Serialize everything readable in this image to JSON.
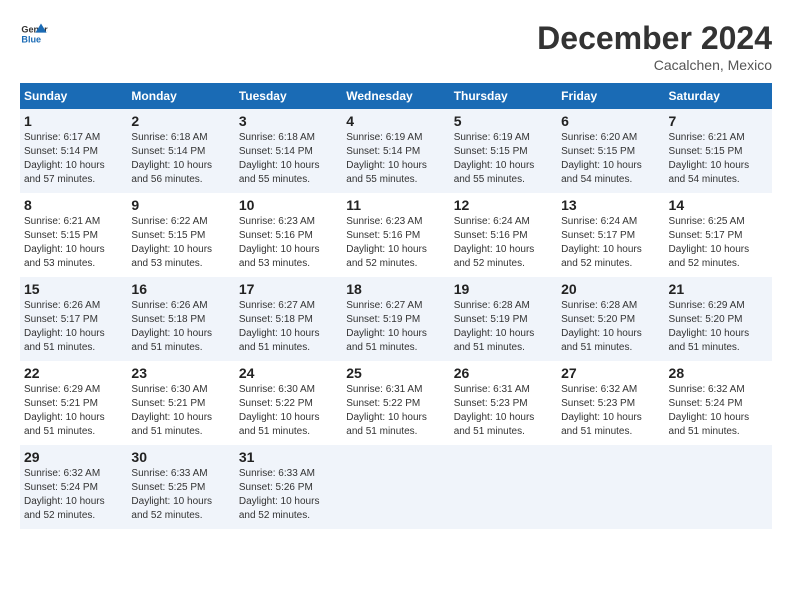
{
  "logo": {
    "line1": "General",
    "line2": "Blue"
  },
  "title": "December 2024",
  "location": "Cacalchen, Mexico",
  "weekdays": [
    "Sunday",
    "Monday",
    "Tuesday",
    "Wednesday",
    "Thursday",
    "Friday",
    "Saturday"
  ],
  "weeks": [
    [
      {
        "day": "1",
        "sunrise": "6:17 AM",
        "sunset": "5:14 PM",
        "daylight": "10 hours and 57 minutes."
      },
      {
        "day": "2",
        "sunrise": "6:18 AM",
        "sunset": "5:14 PM",
        "daylight": "10 hours and 56 minutes."
      },
      {
        "day": "3",
        "sunrise": "6:18 AM",
        "sunset": "5:14 PM",
        "daylight": "10 hours and 55 minutes."
      },
      {
        "day": "4",
        "sunrise": "6:19 AM",
        "sunset": "5:14 PM",
        "daylight": "10 hours and 55 minutes."
      },
      {
        "day": "5",
        "sunrise": "6:19 AM",
        "sunset": "5:15 PM",
        "daylight": "10 hours and 55 minutes."
      },
      {
        "day": "6",
        "sunrise": "6:20 AM",
        "sunset": "5:15 PM",
        "daylight": "10 hours and 54 minutes."
      },
      {
        "day": "7",
        "sunrise": "6:21 AM",
        "sunset": "5:15 PM",
        "daylight": "10 hours and 54 minutes."
      }
    ],
    [
      {
        "day": "8",
        "sunrise": "6:21 AM",
        "sunset": "5:15 PM",
        "daylight": "10 hours and 53 minutes."
      },
      {
        "day": "9",
        "sunrise": "6:22 AM",
        "sunset": "5:15 PM",
        "daylight": "10 hours and 53 minutes."
      },
      {
        "day": "10",
        "sunrise": "6:23 AM",
        "sunset": "5:16 PM",
        "daylight": "10 hours and 53 minutes."
      },
      {
        "day": "11",
        "sunrise": "6:23 AM",
        "sunset": "5:16 PM",
        "daylight": "10 hours and 52 minutes."
      },
      {
        "day": "12",
        "sunrise": "6:24 AM",
        "sunset": "5:16 PM",
        "daylight": "10 hours and 52 minutes."
      },
      {
        "day": "13",
        "sunrise": "6:24 AM",
        "sunset": "5:17 PM",
        "daylight": "10 hours and 52 minutes."
      },
      {
        "day": "14",
        "sunrise": "6:25 AM",
        "sunset": "5:17 PM",
        "daylight": "10 hours and 52 minutes."
      }
    ],
    [
      {
        "day": "15",
        "sunrise": "6:26 AM",
        "sunset": "5:17 PM",
        "daylight": "10 hours and 51 minutes."
      },
      {
        "day": "16",
        "sunrise": "6:26 AM",
        "sunset": "5:18 PM",
        "daylight": "10 hours and 51 minutes."
      },
      {
        "day": "17",
        "sunrise": "6:27 AM",
        "sunset": "5:18 PM",
        "daylight": "10 hours and 51 minutes."
      },
      {
        "day": "18",
        "sunrise": "6:27 AM",
        "sunset": "5:19 PM",
        "daylight": "10 hours and 51 minutes."
      },
      {
        "day": "19",
        "sunrise": "6:28 AM",
        "sunset": "5:19 PM",
        "daylight": "10 hours and 51 minutes."
      },
      {
        "day": "20",
        "sunrise": "6:28 AM",
        "sunset": "5:20 PM",
        "daylight": "10 hours and 51 minutes."
      },
      {
        "day": "21",
        "sunrise": "6:29 AM",
        "sunset": "5:20 PM",
        "daylight": "10 hours and 51 minutes."
      }
    ],
    [
      {
        "day": "22",
        "sunrise": "6:29 AM",
        "sunset": "5:21 PM",
        "daylight": "10 hours and 51 minutes."
      },
      {
        "day": "23",
        "sunrise": "6:30 AM",
        "sunset": "5:21 PM",
        "daylight": "10 hours and 51 minutes."
      },
      {
        "day": "24",
        "sunrise": "6:30 AM",
        "sunset": "5:22 PM",
        "daylight": "10 hours and 51 minutes."
      },
      {
        "day": "25",
        "sunrise": "6:31 AM",
        "sunset": "5:22 PM",
        "daylight": "10 hours and 51 minutes."
      },
      {
        "day": "26",
        "sunrise": "6:31 AM",
        "sunset": "5:23 PM",
        "daylight": "10 hours and 51 minutes."
      },
      {
        "day": "27",
        "sunrise": "6:32 AM",
        "sunset": "5:23 PM",
        "daylight": "10 hours and 51 minutes."
      },
      {
        "day": "28",
        "sunrise": "6:32 AM",
        "sunset": "5:24 PM",
        "daylight": "10 hours and 51 minutes."
      }
    ],
    [
      {
        "day": "29",
        "sunrise": "6:32 AM",
        "sunset": "5:24 PM",
        "daylight": "10 hours and 52 minutes."
      },
      {
        "day": "30",
        "sunrise": "6:33 AM",
        "sunset": "5:25 PM",
        "daylight": "10 hours and 52 minutes."
      },
      {
        "day": "31",
        "sunrise": "6:33 AM",
        "sunset": "5:26 PM",
        "daylight": "10 hours and 52 minutes."
      },
      null,
      null,
      null,
      null
    ]
  ],
  "labels": {
    "sunrise": "Sunrise:",
    "sunset": "Sunset:",
    "daylight": "Daylight:"
  }
}
